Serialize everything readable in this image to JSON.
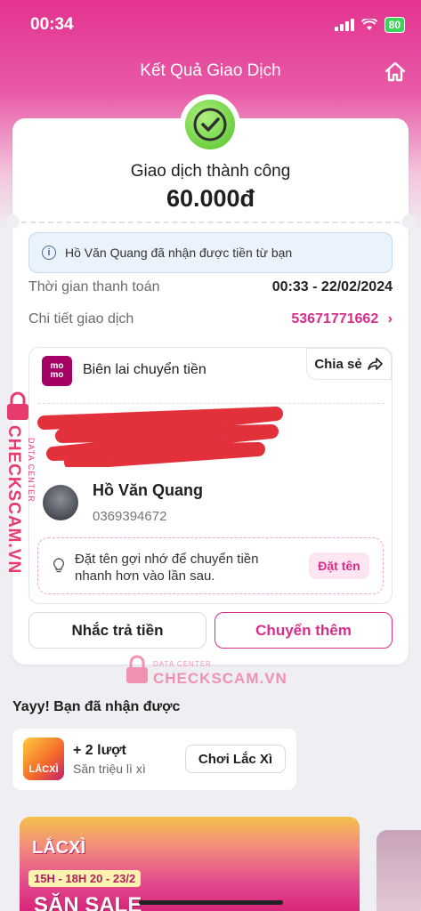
{
  "status_bar": {
    "time": "00:34",
    "battery": "80"
  },
  "header": {
    "title": "Kết Quả Giao Dịch",
    "home_icon": "home-icon"
  },
  "transaction": {
    "status": "Giao dịch thành công",
    "amount": "60.000đ",
    "info_message": "Hồ Văn Quang đã nhận được tiền từ bạn",
    "time_label": "Thời gian thanh toán",
    "time_value": "00:33 - 22/02/2024",
    "detail_label": "Chi tiết giao dịch",
    "detail_value": "53671771662",
    "detail_chevron": "›"
  },
  "receipt": {
    "logo_text_1": "mo",
    "logo_text_2": "mo",
    "title": "Biên lai chuyển tiền",
    "share_label": "Chia sẻ",
    "receiver_name": "Hồ Văn Quang",
    "receiver_phone": "0369394672",
    "nickname_hint": "Đặt tên gợi nhớ để chuyển tiền nhanh hơn vào lần sau.",
    "nickname_button": "Đặt tên"
  },
  "actions": {
    "remind": "Nhắc trả tiền",
    "send_more": "Chuyển thêm"
  },
  "watermark": {
    "brand": "CHECKSCAM.VN",
    "tag": "DATA CENTER"
  },
  "rewards": {
    "section_title": "Yayy! Bạn đã nhận được",
    "image_label": "LẮCXÌ",
    "count": "+ 2 lượt",
    "subtitle": "Săn triệu lì xì",
    "play_button": "Chơi Lắc Xì"
  },
  "banner": {
    "logo": "LẮCXÌ",
    "time": "15H - 18H  20 - 23/2",
    "headline": "SĂN SALE"
  },
  "colors": {
    "brand_pink": "#d82d8b",
    "success_green": "#54c22a",
    "watermark_red": "#e63b6c"
  }
}
